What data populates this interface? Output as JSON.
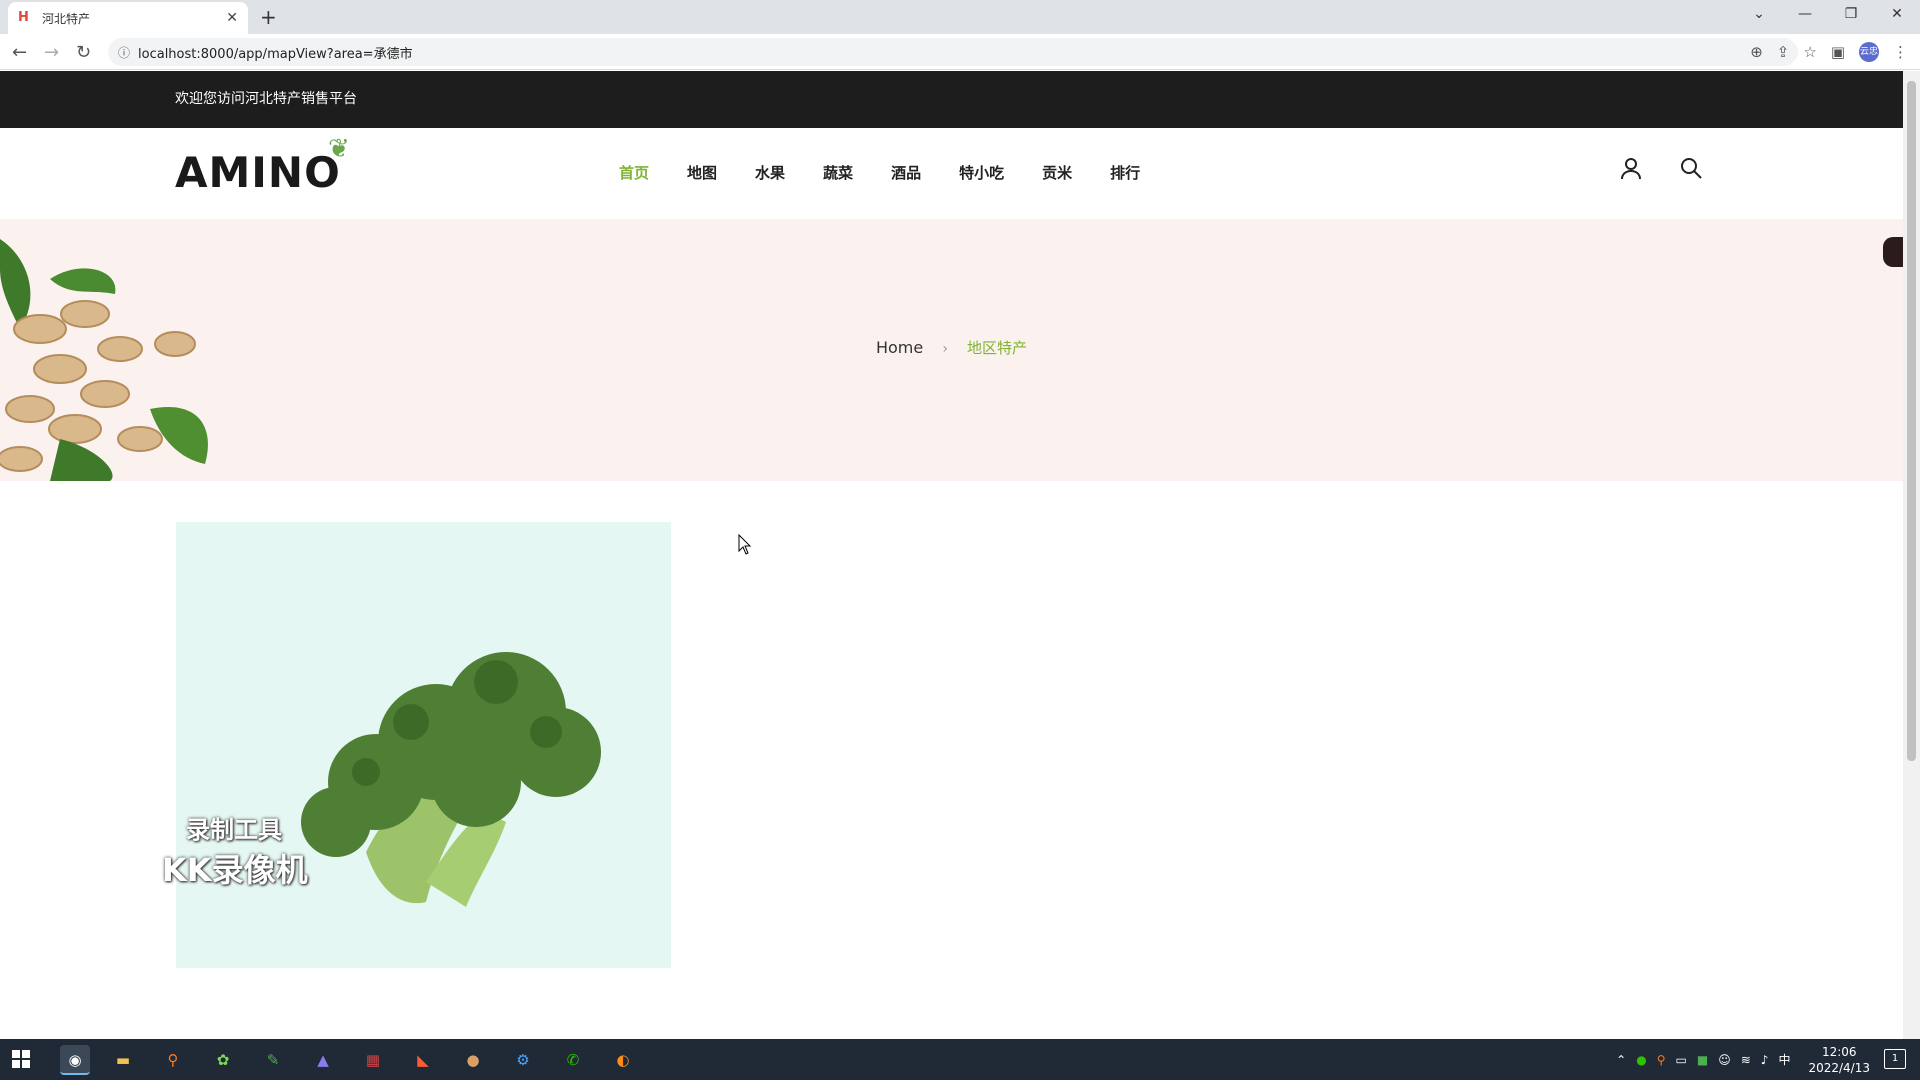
{
  "browser": {
    "tab_title": "河北特产",
    "tab_favicon": "H",
    "url": "localhost:8000/app/mapView?area=承德市",
    "avatar_text": "云忠"
  },
  "site": {
    "welcome": "欢迎您访问河北特产销售平台",
    "logo": "AMINO",
    "menu": [
      "首页",
      "地图",
      "水果",
      "蔬菜",
      "酒品",
      "特小吃",
      "贡米",
      "排行"
    ],
    "active_menu": "首页",
    "accent_color": "#80b435"
  },
  "breadcrumb": {
    "home": "Home",
    "current": "地区特产"
  },
  "watermark": {
    "line1": "录制工具",
    "line2": "KK录像机"
  },
  "taskbar": {
    "time": "12:06",
    "date": "2022/4/13",
    "ime": "中",
    "notification_count": "1"
  }
}
